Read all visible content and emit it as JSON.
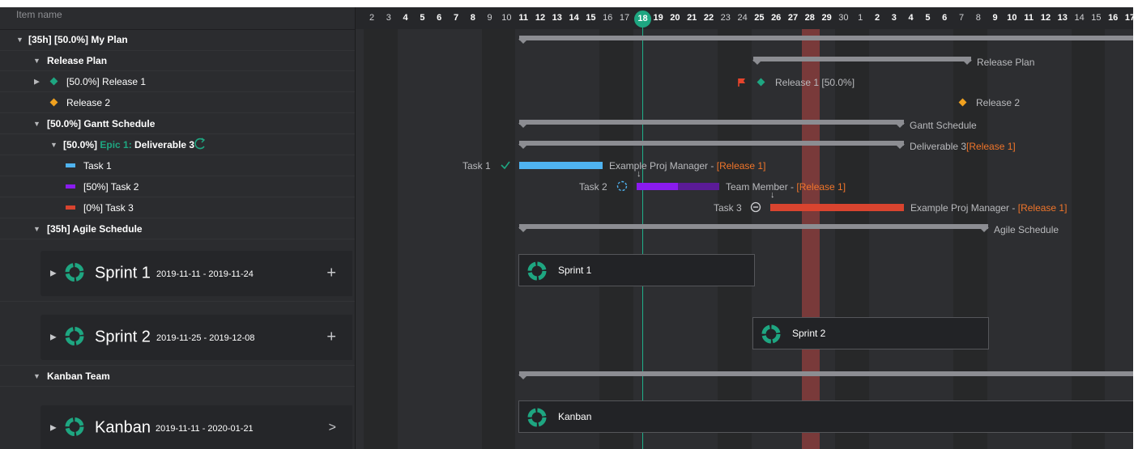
{
  "grid": {
    "header_label": "Item name",
    "rows": [
      {
        "label": "[35h] [50.0%] My Plan",
        "toggle": "▼",
        "bold": true
      },
      {
        "label": "Release Plan",
        "toggle": "▼",
        "bold": true
      },
      {
        "label": "[50.0%] Release 1",
        "toggle": "▶",
        "bold": false,
        "icon": "diamond-green"
      },
      {
        "label": "Release 2",
        "toggle": "",
        "bold": false,
        "icon": "diamond-orange"
      },
      {
        "label": "[50.0%] Gantt Schedule",
        "toggle": "▼",
        "bold": true
      },
      {
        "label_prefix": "[50.0%] ",
        "label_epic": "Epic 1: ",
        "label_main": "Deliverable 3",
        "toggle": "▼",
        "bold": true
      },
      {
        "label": "Task 1",
        "toggle": "",
        "bold": false,
        "icon": "bar-blue"
      },
      {
        "label": "[50%] Task 2",
        "toggle": "",
        "bold": false,
        "icon": "bar-purple"
      },
      {
        "label": "[0%] Task 3",
        "toggle": "",
        "bold": false,
        "icon": "bar-red"
      },
      {
        "label": "[35h] Agile Schedule",
        "toggle": "▼",
        "bold": true
      },
      {
        "label": "Kanban Team",
        "toggle": "▼",
        "bold": true
      }
    ],
    "sprints": [
      {
        "name": "Sprint 1",
        "dates": "2019-11-11 - 2019-11-24",
        "action": "+"
      },
      {
        "name": "Sprint 2",
        "dates": "2019-11-25 - 2019-12-08",
        "action": "+"
      },
      {
        "name": "Kanban",
        "dates": "2019-11-11 - 2020-01-21",
        "action": ">"
      }
    ]
  },
  "timeline": {
    "days": [
      "2",
      "3",
      "4",
      "5",
      "6",
      "7",
      "8",
      "9",
      "10",
      "11",
      "12",
      "13",
      "14",
      "15",
      "16",
      "17",
      "18",
      "19",
      "20",
      "21",
      "22",
      "23",
      "24",
      "25",
      "26",
      "27",
      "28",
      "29",
      "30",
      "1",
      "2",
      "3",
      "4",
      "5",
      "6",
      "7",
      "8",
      "9",
      "10",
      "11",
      "12",
      "13",
      "14",
      "15",
      "16",
      "17"
    ],
    "bold_days": [
      "4",
      "5",
      "6",
      "7",
      "8",
      "11",
      "12",
      "13",
      "14",
      "15",
      "18",
      "19",
      "20",
      "21",
      "22",
      "25",
      "26",
      "27",
      "28",
      "29",
      "2",
      "3",
      "4",
      "5",
      "6",
      "9",
      "10",
      "11",
      "12",
      "13",
      "16",
      "17"
    ],
    "today": "18",
    "labels": {
      "release_plan": "Release Plan",
      "release1": "Release 1 [50.0%]",
      "release2": "Release 2",
      "gantt_schedule": "Gantt Schedule",
      "deliverable3": "Deliverable 3",
      "deliverable3_tag": "[Release 1]",
      "task1_left": "Task 1",
      "task1_owner": "Example Proj Manager - ",
      "task1_tag": "[Release 1]",
      "task2_left": "Task 2",
      "task2_owner": "Team Member - ",
      "task2_tag": "[Release 1]",
      "task3_left": "Task 3",
      "task3_owner": "Example Proj Manager - ",
      "task3_tag": "[Release 1]",
      "agile_schedule": "Agile Schedule",
      "sprint1_box": "Sprint 1",
      "sprint2_box": "Sprint 2",
      "kanban_box": "Kanban"
    }
  },
  "colors": {
    "accent_green": "#1ea681",
    "task1": "#4fb3f0",
    "task2": "#8a1bef",
    "task3": "#d9442f",
    "release_orange": "#f0a11f",
    "tag_orange": "#f0752a"
  }
}
